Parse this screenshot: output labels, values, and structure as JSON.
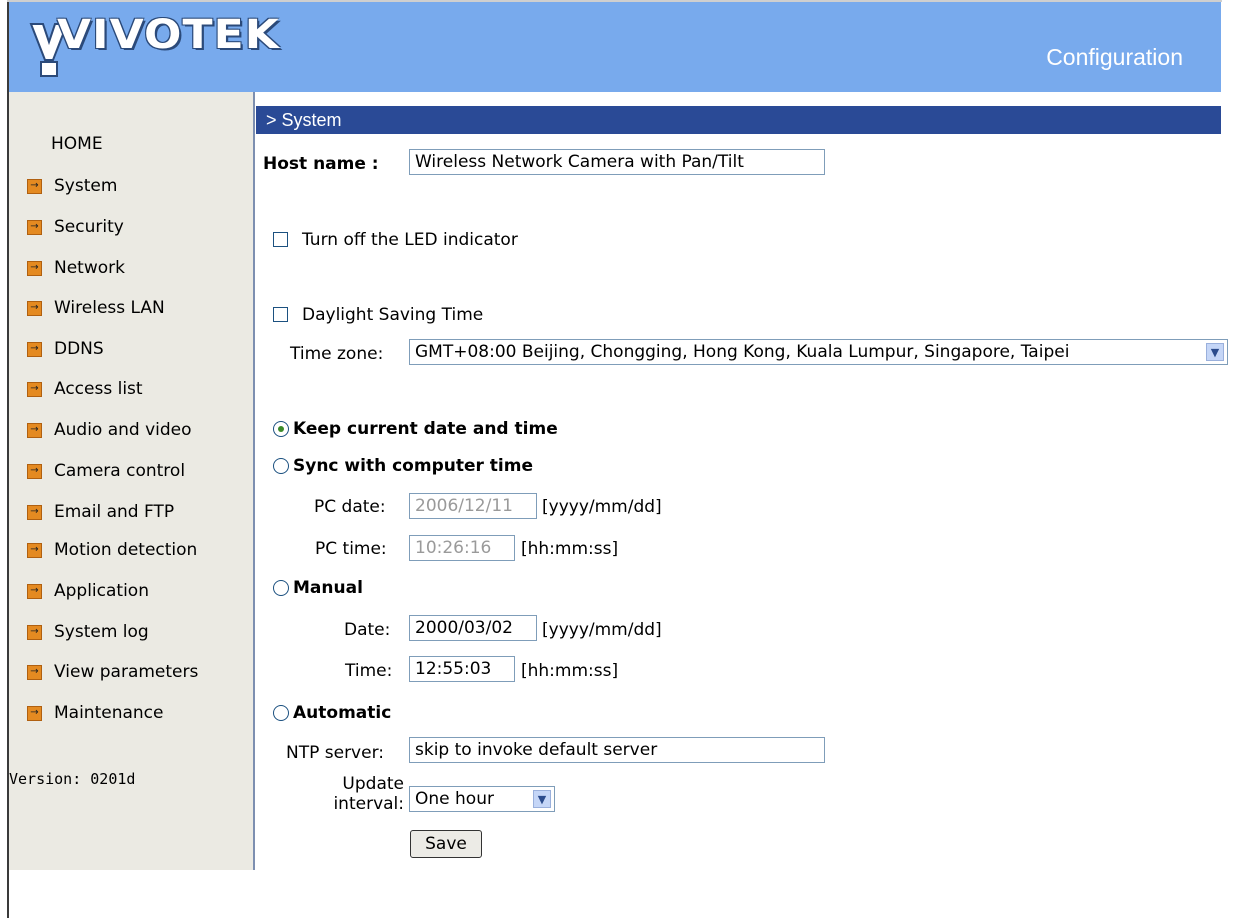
{
  "header": {
    "brand": "VIVOTEK",
    "page_title": "Configuration"
  },
  "sidebar": {
    "home_label": "HOME",
    "items": [
      {
        "label": "System",
        "icon": "arrow-icon"
      },
      {
        "label": "Security",
        "icon": "arrow-icon"
      },
      {
        "label": "Network",
        "icon": "arrow-icon"
      },
      {
        "label": "Wireless LAN",
        "icon": "arrow-icon"
      },
      {
        "label": "DDNS",
        "icon": "arrow-icon"
      },
      {
        "label": "Access list",
        "icon": "arrow-icon"
      },
      {
        "label": "Audio and video",
        "icon": "arrow-icon"
      },
      {
        "label": "Camera control",
        "icon": "arrow-icon"
      },
      {
        "label": "Email and FTP",
        "icon": "arrow-icon"
      },
      {
        "label": "Motion detection",
        "icon": "arrow-icon"
      },
      {
        "label": "Application",
        "icon": "arrow-icon"
      },
      {
        "label": "System log",
        "icon": "arrow-icon"
      },
      {
        "label": "View parameters",
        "icon": "arrow-icon"
      },
      {
        "label": "Maintenance",
        "icon": "arrow-icon"
      }
    ],
    "version": "Version: 0201d"
  },
  "section": {
    "title": "> System"
  },
  "form": {
    "host_name_label": "Host name :",
    "host_name_value": "Wireless Network Camera with Pan/Tilt",
    "led_label": "Turn off the LED indicator",
    "led_checked": false,
    "dst_label": "Daylight Saving Time",
    "dst_checked": false,
    "timezone_label": "Time zone:",
    "timezone_value": "GMT+08:00 Beijing, Chongging, Hong Kong, Kuala Lumpur, Singapore, Taipei",
    "keep_label": "Keep current date and time",
    "sync_label": "Sync with computer time",
    "pc_date_label": "PC date:",
    "pc_date_value": "2006/12/11",
    "pc_date_format": "[yyyy/mm/dd]",
    "pc_time_label": "PC time:",
    "pc_time_value": "10:26:16",
    "pc_time_format": "[hh:mm:ss]",
    "manual_label": "Manual",
    "date_label": "Date:",
    "date_value": "2000/03/02",
    "date_format": "[yyyy/mm/dd]",
    "time_label": "Time:",
    "time_value": "12:55:03",
    "time_format": "[hh:mm:ss]",
    "automatic_label": "Automatic",
    "ntp_label": "NTP server:",
    "ntp_value": "skip to invoke default server",
    "update_label_line1": "Update",
    "update_label_line2": "interval:",
    "update_value": "One hour",
    "save_label": "Save",
    "selected_time_mode": "Keep current date and time"
  }
}
